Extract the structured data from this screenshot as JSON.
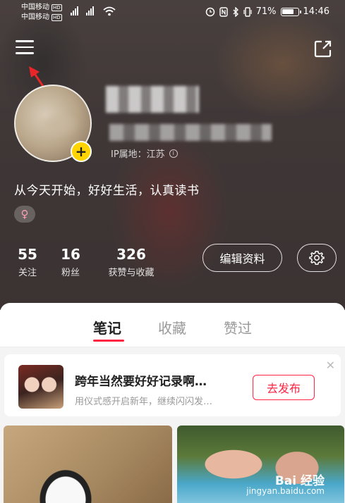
{
  "status_bar": {
    "carrier_1": "中国移动",
    "carrier_2": "中国移动",
    "hd": "HD",
    "battery_percent": "71%",
    "time": "14:46"
  },
  "profile": {
    "ip_location": "IP属地：江苏",
    "bio": "从今天开始，好好生活，认真读书",
    "gender_symbol": "♀",
    "avatar_add": "+"
  },
  "stats": [
    {
      "value": "55",
      "label": "关注"
    },
    {
      "value": "16",
      "label": "粉丝"
    },
    {
      "value": "326",
      "label": "获赞与收藏"
    }
  ],
  "actions": {
    "edit_profile": "编辑资料"
  },
  "tabs": [
    {
      "label": "笔记",
      "active": true
    },
    {
      "label": "收藏",
      "active": false
    },
    {
      "label": "赞过",
      "active": false
    }
  ],
  "promo": {
    "title": "跨年当然要好好记录啊…",
    "subtitle": "用仪式感开启新年，继续闪闪发…",
    "button": "去发布",
    "close": "✕"
  },
  "watermark": {
    "brand": "Bai 经验",
    "url": "jingyan.baidu.com"
  },
  "colors": {
    "accent": "#ff2442",
    "avatar_badge": "#ffd400"
  }
}
